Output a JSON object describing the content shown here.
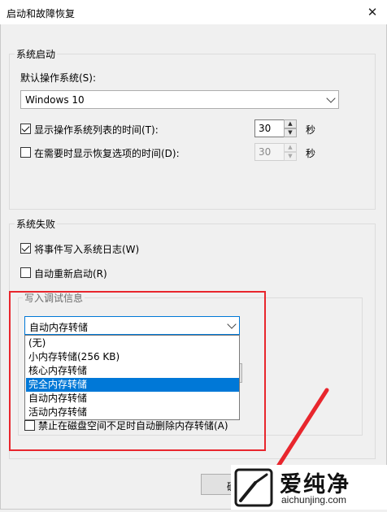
{
  "window": {
    "title": "启动和故障恢复",
    "close_icon": "close-icon"
  },
  "startup": {
    "group_label": "系统启动",
    "default_os_label": "默认操作系统(S):",
    "default_os_value": "Windows 10",
    "show_list_label": "显示操作系统列表的时间(T):",
    "show_list_checked": true,
    "show_list_value": "30",
    "show_recovery_label": "在需要时显示恢复选项的时间(D):",
    "show_recovery_checked": false,
    "show_recovery_value": "30",
    "seconds_unit": "秒"
  },
  "failure": {
    "group_label": "系统失败",
    "write_event_label": "将事件写入系统日志(W)",
    "write_event_checked": true,
    "auto_restart_label": "自动重新启动(R)",
    "auto_restart_checked": false,
    "debug_group_label": "写入调试信息",
    "debug_selected": "自动内存转储",
    "debug_options": [
      "(无)",
      "小内存转储(256 KB)",
      "核心内存转储",
      "完全内存转储",
      "自动内存转储",
      "活动内存转储"
    ],
    "highlighted_option": "完全内存转储",
    "disable_delete_label": "禁止在磁盘空间不足时自动删除内存转储(A)"
  },
  "footer": {
    "ok_label_partial": "确"
  },
  "watermark": {
    "site_name": "爱纯净",
    "url": "aichunjing.com"
  },
  "colors": {
    "highlight": "#e8262d",
    "selection": "#0078d7"
  }
}
